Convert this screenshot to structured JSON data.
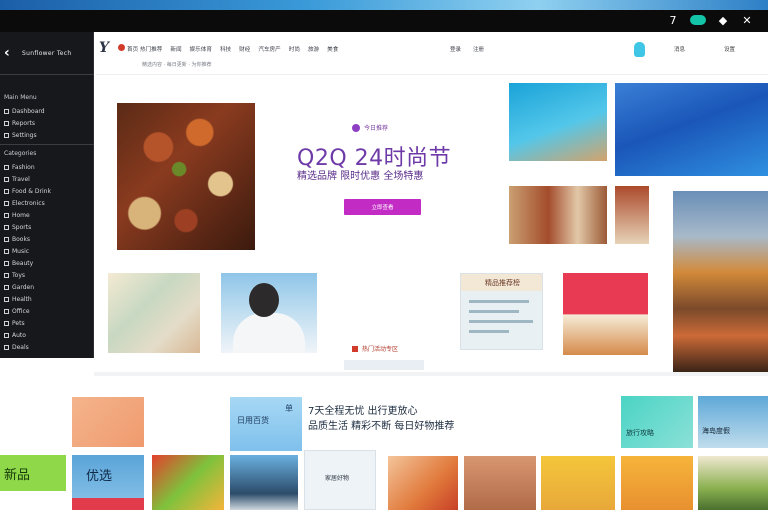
{
  "window": {
    "controls": [
      "7",
      "",
      "◆",
      "✕"
    ]
  },
  "sidebar": {
    "brand": "Sunflower Tech",
    "sections": [
      "Main Menu",
      "Categories"
    ],
    "top_items": [
      "Dashboard",
      "Reports",
      "Settings"
    ],
    "items": [
      "Fashion",
      "Travel",
      "Food & Drink",
      "Electronics",
      "Home",
      "Sports",
      "Books",
      "Music",
      "Beauty",
      "Toys",
      "Garden",
      "Health",
      "Office",
      "Pets",
      "Auto",
      "Deals"
    ]
  },
  "header": {
    "logo": "Y",
    "nav": [
      "首页 热门推荐",
      "新闻",
      "娱乐体育",
      "科技",
      "财经",
      "汽车房产",
      "时尚",
      "旅游",
      "美食"
    ],
    "sub": "精选内容 · 每日更新 · 为你推荐",
    "right_links": [
      "登录",
      "注册"
    ],
    "hdr_r1": "消息",
    "hdr_r2": "设置"
  },
  "hero": {
    "badge_text": "今日推荐",
    "title": "Q2Q 24时尚节",
    "subtitle": "精选品牌 限时优惠 全场特惠",
    "cta": "立即查看"
  },
  "tiles": {
    "card_heading": "精品推荐榜",
    "caption_mid": "热门活动专区",
    "headline_line1": "7天全程无忧 出行更放心",
    "headline_line2": "品质生活 精彩不断 每日好物推荐",
    "teal_label": "旅行攻略",
    "sea_label": "海岛度假",
    "green_label": "新品",
    "blue2_label": "优选",
    "sky_label": "日用百货",
    "sky_tag": "单",
    "card2_label": "家居好物"
  },
  "colors": {
    "accent": "#c32cc4",
    "title": "#6e3aa8",
    "sidebar_bg": "#16181c"
  }
}
